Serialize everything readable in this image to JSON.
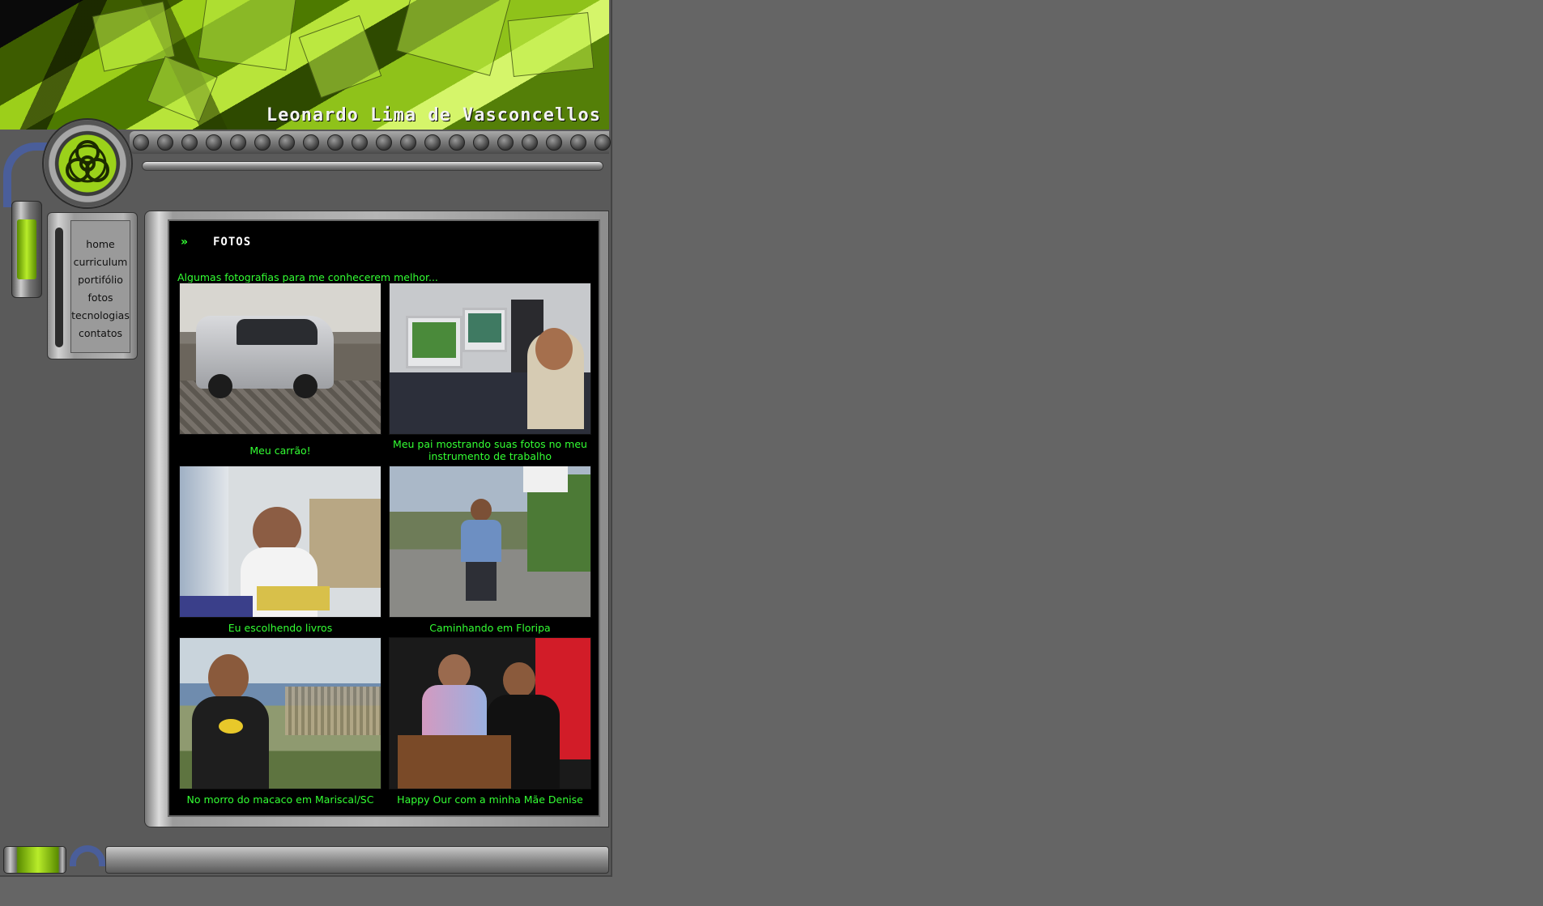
{
  "header": {
    "title": "Leonardo Lima de Vasconcellos",
    "badge_icon": "biohazard-icon"
  },
  "nav": {
    "items": [
      {
        "label": "home"
      },
      {
        "label": "curriculum"
      },
      {
        "label": "portifólio"
      },
      {
        "label": "fotos"
      },
      {
        "label": "tecnologias"
      },
      {
        "label": "contatos"
      }
    ]
  },
  "section": {
    "arrow_icon": "»",
    "title": "FOTOS",
    "intro": "Algumas fotografias para me conhecerem melhor..."
  },
  "photos": [
    {
      "caption": "Meu carrão!"
    },
    {
      "caption": "Meu pai mostrando suas fotos no meu instrumento de trabalho"
    },
    {
      "caption": "Eu escolhendo livros"
    },
    {
      "caption": "Caminhando em Floripa"
    },
    {
      "caption": "No morro do macaco em Mariscal/SC"
    },
    {
      "caption": "Happy Our com a minha Mãe Denise"
    }
  ],
  "colors": {
    "accent_green": "#33ff33",
    "page_bg": "#656565",
    "content_bg": "#000000"
  }
}
